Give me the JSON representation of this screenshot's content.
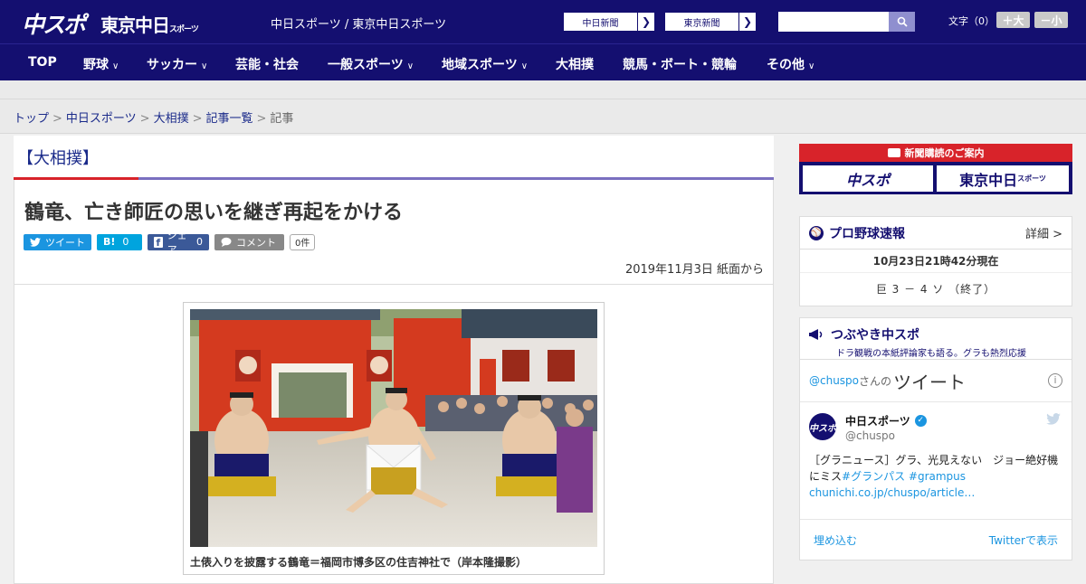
{
  "header": {
    "logo_main": "中スポ",
    "logo_tokyo": "東京中日",
    "logo_tokyo_small": "スポーツ",
    "site_sub": "中日スポーツ / 東京中日スポーツ",
    "ext_links": [
      {
        "label": "中日新聞"
      },
      {
        "label": "東京新聞"
      }
    ],
    "search_placeholder": "",
    "font_label": "文字（0）",
    "font_bigger": "＋大",
    "font_smaller": "－小"
  },
  "nav": {
    "items": [
      {
        "label": "TOP",
        "has_menu": false
      },
      {
        "label": "野球",
        "has_menu": true
      },
      {
        "label": "サッカー",
        "has_menu": true
      },
      {
        "label": "芸能・社会",
        "has_menu": false
      },
      {
        "label": "一般スポーツ",
        "has_menu": true
      },
      {
        "label": "地域スポーツ",
        "has_menu": true
      },
      {
        "label": "大相撲",
        "has_menu": false
      },
      {
        "label": "競馬・ボート・競輪",
        "has_menu": false
      },
      {
        "label": "その他",
        "has_menu": true
      }
    ]
  },
  "breadcrumb": {
    "items": [
      "トップ",
      "中日スポーツ",
      "大相撲",
      "記事一覧"
    ],
    "current": "記事"
  },
  "article": {
    "category": "【大相撲】",
    "headline": "鶴竜、亡き師匠の思いを継ぎ再起をかける",
    "share": {
      "tweet": "ツイート",
      "hatena": "B!",
      "hatena_count": "0",
      "facebook": "シェア",
      "facebook_count": "0",
      "comment": "コメント",
      "comment_count": "0件"
    },
    "date": "2019年11月3日 紙面から",
    "caption": "土俵入りを披露する鶴竜＝福岡市博多区の住吉神社で（岸本隆撮影）"
  },
  "sidebar": {
    "subscribe": {
      "title": "新聞購読のご案内",
      "logo1": "中スポ",
      "logo2": "東京中日",
      "logo2_small": "スポーツ"
    },
    "baseball": {
      "title": "プロ野球速報",
      "more": "詳細 >",
      "time": "10月23日21時42分現在",
      "score": "巨 3 － 4 ソ （終了）"
    },
    "twitter": {
      "title": "つぶやき中スポ",
      "subtitle": "ドラ観戦の本紙評論家も語る。グラも熱烈応援",
      "handle": "@chuspo",
      "handle_suffix": "さんの",
      "big": "ツイート",
      "tweet_name": "中日スポーツ",
      "tweet_user": "@chuspo",
      "avatar_text": "中スポ",
      "tweet_text": "［グラニュース］グラ、光見えない　ジョー絶好機にミス",
      "tag1": "#グランパス",
      "tag2": "#grampus",
      "tweet_link": "chunichi.co.jp/chuspo/article…",
      "embed": "埋め込む",
      "view": "Twitterで表示"
    }
  },
  "colors": {
    "brand_navy": "#140f70",
    "accent_red": "#d8232a",
    "accent_purple": "#7a6fc0",
    "twitter_blue": "#1b95e0"
  }
}
